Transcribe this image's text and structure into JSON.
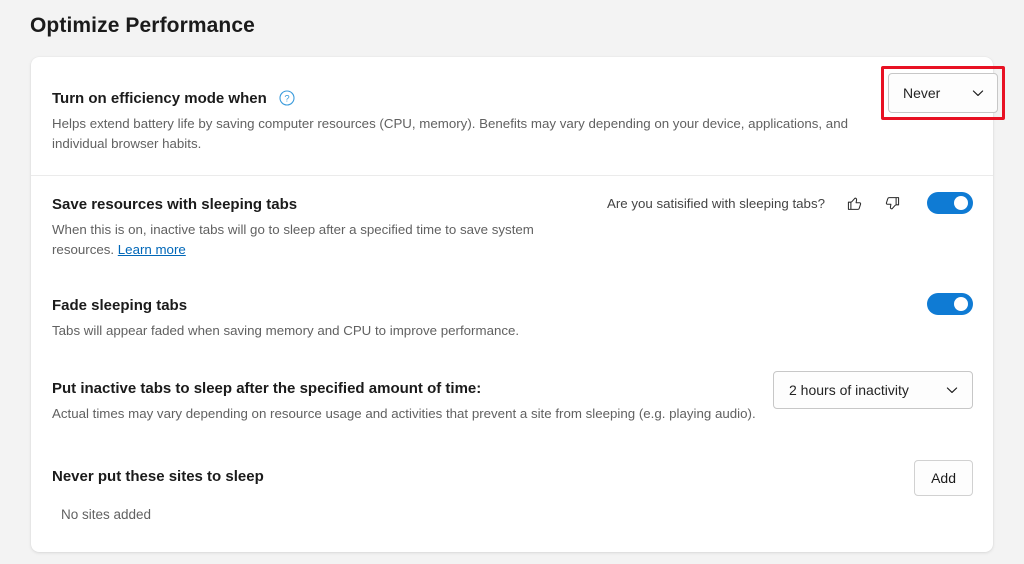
{
  "page": {
    "title": "Optimize Performance",
    "background_color": "#f3f3f3",
    "card_color": "#ffffff",
    "accent_color": "#0f7bd4",
    "highlight_color": "#e81123",
    "link_color": "#0067b8"
  },
  "settings": {
    "efficiency_mode": {
      "title": "Turn on efficiency mode when",
      "help_icon": "question-circle-icon",
      "description": "Helps extend battery life by saving computer resources (CPU, memory). Benefits may vary depending on your device, applications, and individual browser habits.",
      "dropdown_value": "Never",
      "dropdown_icon": "chevron-down-icon",
      "highlighted": true
    },
    "sleeping_tabs": {
      "title": "Save resources with sleeping tabs",
      "description_part1": "When this is on, inactive tabs will go to sleep after a specified time to save system resources.",
      "learn_more_label": "Learn more",
      "feedback_question": "Are you satisified with sleeping tabs?",
      "thumbs_up_icon": "thumbs-up-icon",
      "thumbs_down_icon": "thumbs-down-icon",
      "toggle_state": "on"
    },
    "fade_sleeping_tabs": {
      "title": "Fade sleeping tabs",
      "description": "Tabs will appear faded when saving memory and CPU to improve performance.",
      "toggle_state": "on"
    },
    "inactive_timeout": {
      "title": "Put inactive tabs to sleep after the specified amount of time:",
      "description": "Actual times may vary depending on resource usage and activities that prevent a site from sleeping (e.g. playing audio).",
      "dropdown_value": "2 hours of inactivity",
      "dropdown_icon": "chevron-down-icon"
    },
    "never_sleep_sites": {
      "title": "Never put these sites to sleep",
      "add_button_label": "Add",
      "empty_state": "No sites added"
    }
  }
}
